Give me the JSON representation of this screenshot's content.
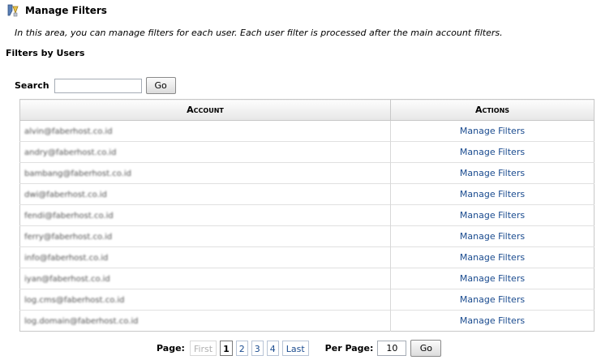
{
  "page": {
    "title": "Manage Filters",
    "intro": "In this area, you can manage filters for each user. Each user filter is processed after the main account filters.",
    "section_title": "Filters by Users"
  },
  "search": {
    "label": "Search",
    "value": "",
    "button": "Go"
  },
  "table": {
    "headers": {
      "account": "Account",
      "actions": "Actions"
    },
    "rows": [
      {
        "account": "alvin@faberhost.co.id",
        "action": "Manage Filters"
      },
      {
        "account": "andry@faberhost.co.id",
        "action": "Manage Filters"
      },
      {
        "account": "bambang@faberhost.co.id",
        "action": "Manage Filters"
      },
      {
        "account": "dwi@faberhost.co.id",
        "action": "Manage Filters"
      },
      {
        "account": "fendi@faberhost.co.id",
        "action": "Manage Filters"
      },
      {
        "account": "ferry@faberhost.co.id",
        "action": "Manage Filters"
      },
      {
        "account": "info@faberhost.co.id",
        "action": "Manage Filters"
      },
      {
        "account": "iyan@faberhost.co.id",
        "action": "Manage Filters"
      },
      {
        "account": "log.cms@faberhost.co.id",
        "action": "Manage Filters"
      },
      {
        "account": "log.domain@faberhost.co.id",
        "action": "Manage Filters"
      }
    ]
  },
  "pagination": {
    "label": "Page:",
    "first": "First",
    "pages": [
      "1",
      "2",
      "3",
      "4"
    ],
    "current": "1",
    "last": "Last",
    "per_page_label": "Per Page:",
    "per_page_value": "10",
    "go": "Go"
  },
  "colors": {
    "link": "#1a4b8f",
    "border": "#c8c8c8"
  }
}
